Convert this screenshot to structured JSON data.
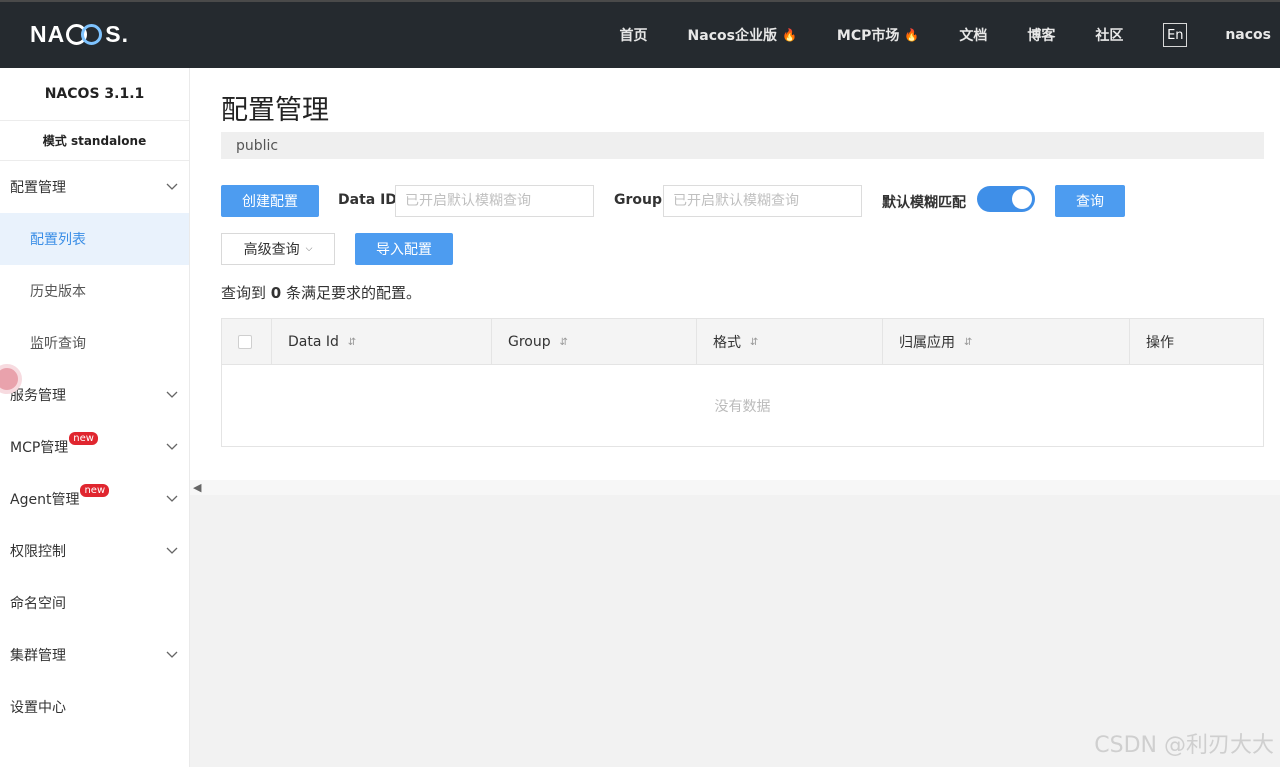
{
  "header": {
    "logo": {
      "left": "NA",
      "right": "S."
    },
    "nav": [
      {
        "label": "首页",
        "hot": false
      },
      {
        "label": "Nacos企业版",
        "hot": true
      },
      {
        "label": "MCP市场",
        "hot": true
      },
      {
        "label": "文档",
        "hot": false
      },
      {
        "label": "博客",
        "hot": false
      },
      {
        "label": "社区",
        "hot": false
      }
    ],
    "lang_button": "En",
    "user": "nacos"
  },
  "sidebar": {
    "version": "NACOS 3.1.1",
    "mode": "模式 standalone",
    "items": [
      {
        "label": "配置管理",
        "level": 1,
        "expandable": true
      },
      {
        "label": "配置列表",
        "level": 2,
        "active": true
      },
      {
        "label": "历史版本",
        "level": 2
      },
      {
        "label": "监听查询",
        "level": 2
      },
      {
        "label": "服务管理",
        "level": 1,
        "expandable": true
      },
      {
        "label": "MCP管理",
        "level": 1,
        "expandable": true,
        "badge": "new"
      },
      {
        "label": "Agent管理",
        "level": 1,
        "expandable": true,
        "badge": "new"
      },
      {
        "label": "权限控制",
        "level": 1,
        "expandable": true
      },
      {
        "label": "命名空间",
        "level": 1
      },
      {
        "label": "集群管理",
        "level": 1,
        "expandable": true
      },
      {
        "label": "设置中心",
        "level": 1
      }
    ]
  },
  "main": {
    "title": "配置管理",
    "namespace": "public",
    "create_button": "创建配置",
    "data_id_label": "Data ID",
    "data_id_placeholder": "已开启默认模糊查询",
    "group_label": "Group",
    "group_placeholder": "已开启默认模糊查询",
    "fuzzy_label": "默认模糊匹配",
    "fuzzy_enabled": true,
    "query_button": "查询",
    "advanced_button": "高级查询",
    "import_button": "导入配置",
    "result_prefix": "查询到",
    "result_count": "0",
    "result_suffix": "条满足要求的配置。",
    "table": {
      "columns": [
        "Data Id",
        "Group",
        "格式",
        "归属应用",
        "操作"
      ],
      "empty_text": "没有数据"
    }
  },
  "watermark": "CSDN @利刃大大",
  "colors": {
    "primary": "#4d9cf0",
    "topbar": "#252a2f",
    "badge": "#e0262f"
  }
}
